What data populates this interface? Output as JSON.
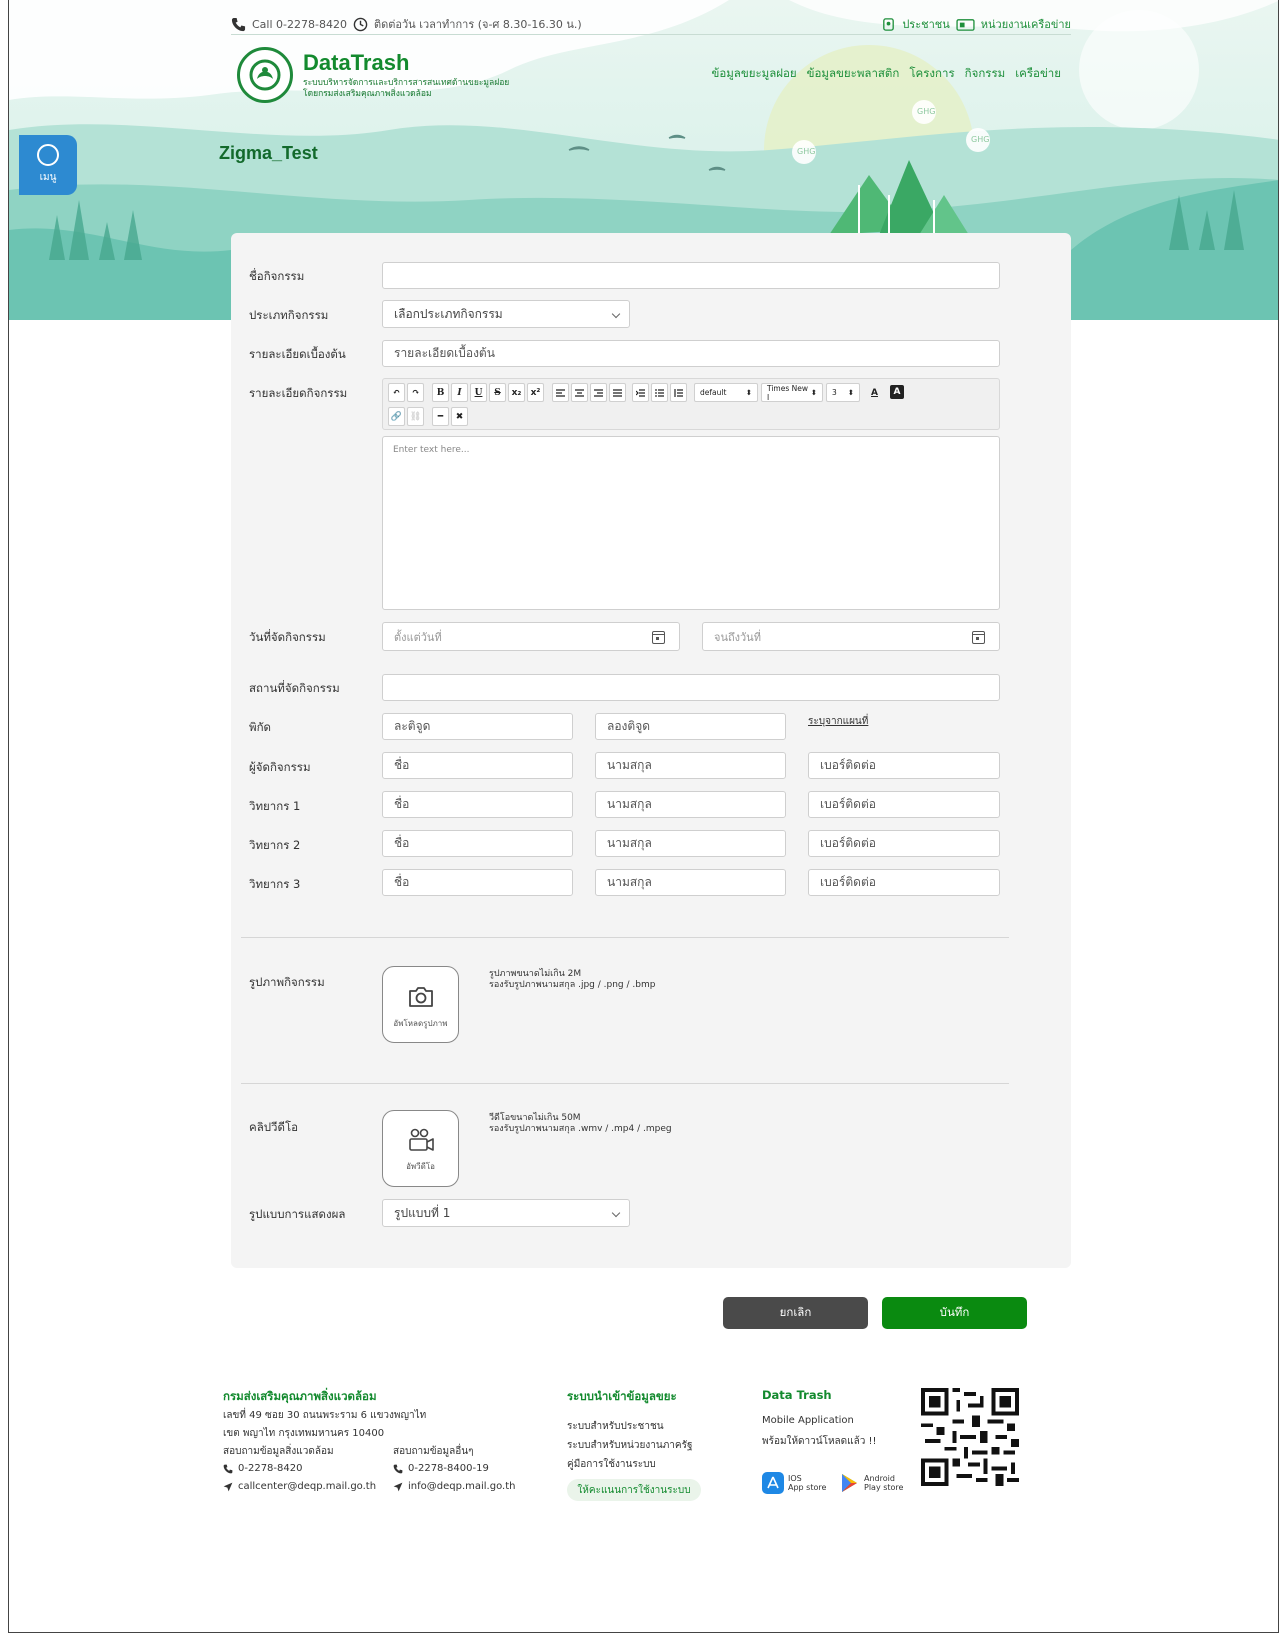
{
  "topbar": {
    "call": "Call 0-2278-8420",
    "hours": "ติดต่อวัน เวลาทำการ (จ-ศ 8.30-16.30 น.)",
    "citizen": "ประชาชน",
    "agency": "หน่วยงานเครือข่าย"
  },
  "brand": {
    "name": "DataTrash",
    "sub1": "ระบบบริหารจัดการและบริการสารสนเทศด้านขยะมูลฝอย",
    "sub2": "โดยกรมส่งเสริมคุณภาพสิ่งแวดล้อม"
  },
  "nav": [
    "ข้อมูลขยะมูลฝอย",
    "ข้อมูลขยะพลาสติก",
    "โครงการ",
    "กิจกรรม",
    "เครือข่าย"
  ],
  "hero": {
    "ghg": "GHG"
  },
  "menu": {
    "label": "เมนู"
  },
  "page": {
    "title": "Zigma_Test"
  },
  "form": {
    "name_label": "ชื่อกิจกรรม",
    "name_value": "",
    "type_label": "ประเภทกิจกรรม",
    "type_value": "เลือกประเภทกิจกรรม",
    "summary_label": "รายละเอียดเบื้องต้น",
    "summary_placeholder": "รายละเอียดเบื้องต้น",
    "detail_label": "รายละเอียดกิจกรรม",
    "toolbar": {
      "undo": "↶",
      "redo": "↷",
      "bold": "B",
      "italic": "I",
      "underline": "U",
      "strike": "S",
      "sub": "x₂",
      "sup": "x²",
      "format": "default",
      "font": "Times New I",
      "size": "3",
      "color": "A",
      "bg": "A",
      "link": "🔗",
      "unlink": "⛓",
      "hr": "━",
      "clear": "✖"
    },
    "editor_placeholder": "Enter text here...",
    "date_label": "วันที่จัดกิจกรรม",
    "date_from": "ตั้งแต่วันที่",
    "date_to": "จนถึงวันที่",
    "place_label": "สถานที่จัดกิจกรรม",
    "coords_label": "พิกัด",
    "lat": "ละติจูด",
    "lng": "ลองติจูด",
    "map_link": "ระบุจากแผนที่",
    "organizer_label": "ผู้จัดกิจกรรม",
    "speaker1_label": "วิทยากร 1",
    "speaker2_label": "วิทยากร 2",
    "speaker3_label": "วิทยากร 3",
    "first_name": "ชื่อ",
    "last_name": "นามสกุล",
    "phone": "เบอร์ติดต่อ",
    "image_label": "รูปภาพกิจกรรม",
    "image_upload": "อัพโหลดรูปภาพ",
    "image_info1": "รูปภาพขนาดไม่เกิน 2M",
    "image_info2": "รองรับรูปภาพนามสกุล .jpg / .png / .bmp",
    "video_label": "คลิปวีดีโอ",
    "video_upload": "อัพวีดีโอ",
    "video_info1": "วีดีโอขนาดไม่เกิน 50M",
    "video_info2": "รองรับรูปภาพนามสกุล .wmv / .mp4 / .mpeg",
    "display_label": "รูปแบบการแสดงผล",
    "display_value": "รูปแบบที่ 1"
  },
  "actions": {
    "cancel": "ยกเลิก",
    "save": "บันทึก"
  },
  "footer": {
    "org": "กรมส่งเสริมคุณภาพสิ่งแวดล้อม",
    "addr1": "เลขที่ 49 ซอย 30 ถนนพระราม 6 แขวงพญาไท",
    "addr2": "เขต พญาไท กรุงเทพมหานคร 10400",
    "env_info": "สอบถามข้อมูลสิ่งแวดล้อม",
    "env_phone": "0-2278-8420",
    "env_email": "callcenter@deqp.mail.go.th",
    "other_info": "สอบถามข้อมูลอื่นๆ",
    "other_phone": "0-2278-8400-19",
    "other_email": "info@deqp.mail.go.th",
    "import_head": "ระบบนำเข้าข้อมูลขยะ",
    "import1": "ระบบสำหรับประชาชน",
    "import2": "ระบบสำหรับหน่วยงานภาครัฐ",
    "import3": "คู่มือการใช้งานระบบ",
    "rate": "ให้คะแนนการใช้งานระบบ",
    "app_head": "Data Trash",
    "app1": "Mobile Application",
    "app2": "พร้อมให้ดาวน์โหลดแล้ว !!",
    "ios1": "IOS",
    "ios2": "App store",
    "android1": "Android",
    "android2": "Play store"
  },
  "colors": {
    "brand_green": "#138a2e",
    "save": "#0a8a10",
    "cancel": "#4a4a4a",
    "menu_blue": "#2d8ad1"
  }
}
